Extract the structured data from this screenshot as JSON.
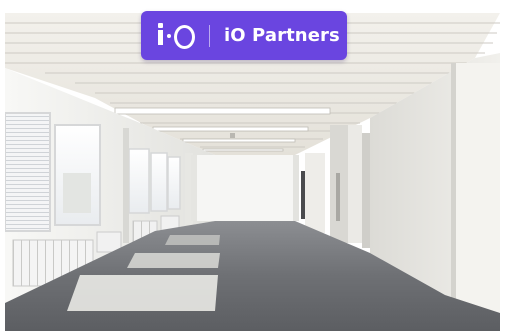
{
  "logo": {
    "mark_text": "i·O",
    "wordmark": "iO Partners",
    "brand_color": "#6a45e0"
  },
  "scene": {
    "subject": "empty-office-room",
    "colors": {
      "ceiling": "#f3f1ec",
      "walls": "#f2f1ee",
      "carpet": "#6e7074",
      "radiator": "#f4f4f4"
    }
  }
}
